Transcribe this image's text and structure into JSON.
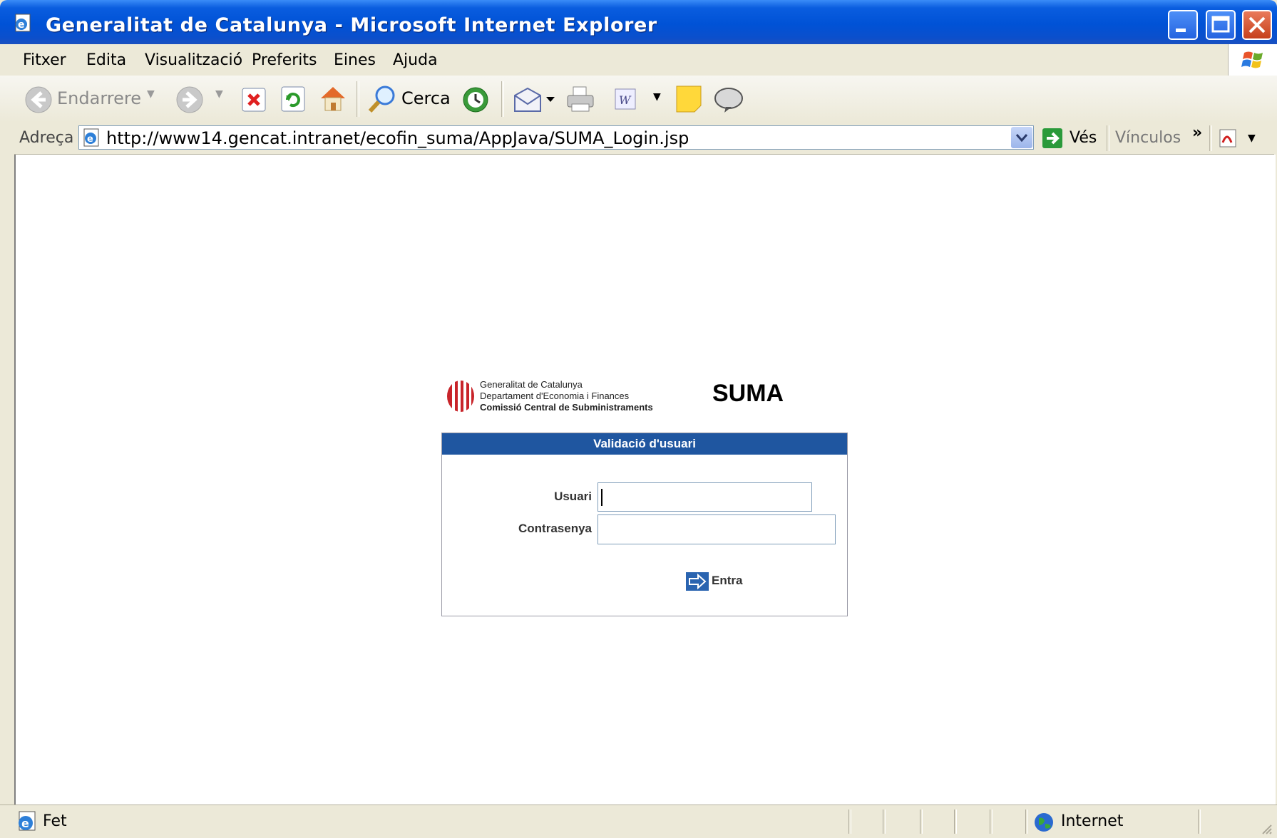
{
  "window": {
    "title": "Generalitat de Catalunya - Microsoft Internet Explorer"
  },
  "menu": {
    "items": [
      "Fitxer",
      "Edita",
      "Visualització",
      "Preferits",
      "Eines",
      "Ajuda"
    ]
  },
  "toolbar": {
    "back_label": "Endarrere",
    "search_label": "Cerca"
  },
  "address": {
    "label": "Adreça",
    "url": "http://www14.gencat.intranet/ecofin_suma/AppJava/SUMA_Login.jsp",
    "go_label": "Vés",
    "links_label": "Vínculos",
    "chevron": "»"
  },
  "page": {
    "org": {
      "line1": "Generalitat de Catalunya",
      "line2": "Departament d'Economia i Finances",
      "line3": "Comissió Central de Subministraments"
    },
    "app_name": "SUMA",
    "login": {
      "heading": "Validació d'usuari",
      "user_label": "Usuari",
      "password_label": "Contrasenya",
      "user_value": "",
      "password_value": "",
      "submit_label": "Entra"
    }
  },
  "status": {
    "text": "Fet",
    "zone": "Internet"
  },
  "colors": {
    "panel_header": "#1f56a0",
    "titlebar": "#0052d6"
  }
}
